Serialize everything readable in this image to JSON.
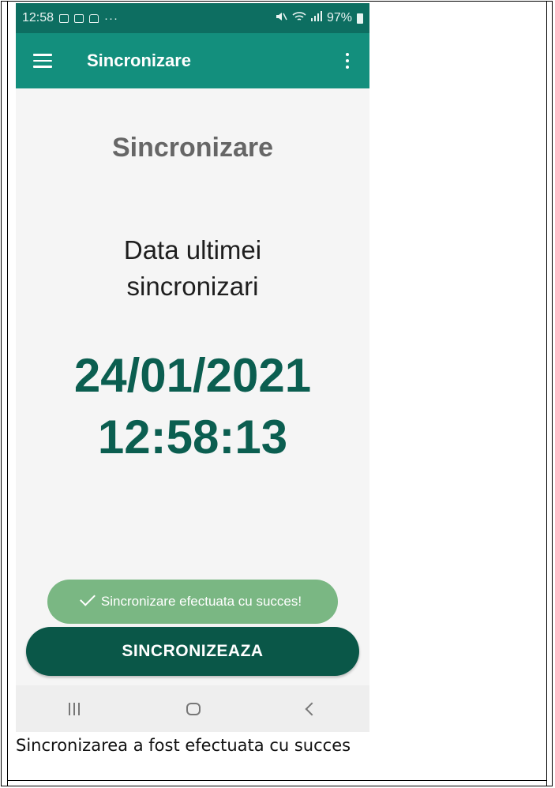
{
  "status_bar": {
    "time": "12:58",
    "more": "···",
    "signal": "​🔇",
    "battery": "97%"
  },
  "app_bar": {
    "title": "Sincronizare"
  },
  "main": {
    "heading": "Sincronizare",
    "last_sync_label_line1": "Data ultimei",
    "last_sync_label_line2": "sincronizari",
    "last_sync_date": "24/01/2021",
    "last_sync_time": "12:58:13"
  },
  "toast": {
    "message": "Sincronizare efectuata cu succes!"
  },
  "actions": {
    "sync_button_label": "SINCRONIZEAZA"
  },
  "caption": {
    "text": "Sincronizarea a fost efectuata cu succes"
  },
  "colors": {
    "status_bar": "#0d6e61",
    "app_bar": "#138f7d",
    "datetime_text": "#0b5e50",
    "toast_bg": "#7ab783",
    "button_bg": "#0a5748"
  },
  "icons": [
    "image-icon",
    "calendar-icon",
    "bag-icon",
    "mute-icon",
    "wifi-icon",
    "signal-icon",
    "battery-icon",
    "menu-icon",
    "more-vert-icon",
    "check-icon",
    "recents-icon",
    "home-icon",
    "back-icon"
  ]
}
